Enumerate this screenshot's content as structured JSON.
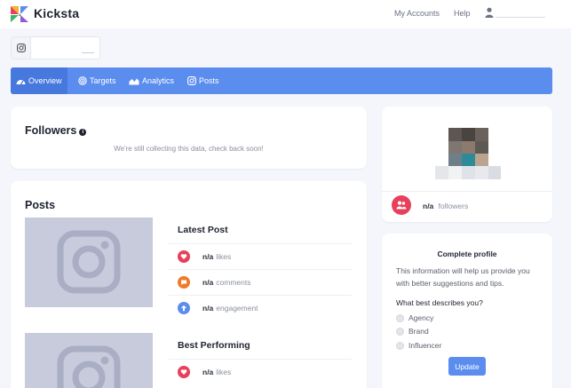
{
  "header": {
    "brand": "Kicksta",
    "links": {
      "my_accounts": "My Accounts",
      "help": "Help"
    },
    "icons": {
      "logo": "kicksta-logo",
      "user": "user-icon"
    }
  },
  "account": {
    "icon": "instagram-icon"
  },
  "nav": {
    "tabs": [
      {
        "label": "Overview",
        "icon": "dashboard-icon",
        "active": true
      },
      {
        "label": "Targets",
        "icon": "target-icon",
        "active": false
      },
      {
        "label": "Analytics",
        "icon": "chart-icon",
        "active": false
      },
      {
        "label": "Posts",
        "icon": "instagram-icon",
        "active": false
      }
    ]
  },
  "followers_card": {
    "title": "Followers",
    "message": "We're still collecting this data, check back soon!"
  },
  "posts_card": {
    "title": "Posts",
    "latest": {
      "title": "Latest Post",
      "stats": [
        {
          "value": "n/a",
          "label": "likes",
          "icon": "heart-icon",
          "color": "#e8405a"
        },
        {
          "value": "n/a",
          "label": "comments",
          "icon": "comment-icon",
          "color": "#f07a2a"
        },
        {
          "value": "n/a",
          "label": "engagement",
          "icon": "arrow-up-icon",
          "color": "#5b8dee"
        }
      ]
    },
    "best": {
      "title": "Best Performing",
      "stats": [
        {
          "value": "n/a",
          "label": "likes",
          "icon": "heart-icon",
          "color": "#e8405a"
        }
      ]
    }
  },
  "profile_card": {
    "followers_value": "n/a",
    "followers_label": "followers",
    "followers_icon": "people-icon"
  },
  "complete_profile": {
    "title": "Complete profile",
    "description_line1": "This information will help us provide you",
    "description_line2": "with better suggestions and tips.",
    "question": "What best describes you?",
    "options": [
      "Agency",
      "Brand",
      "Influencer"
    ],
    "button": "Update"
  },
  "colors": {
    "accent": "#5b8dee",
    "accent_active": "#4778de",
    "likes": "#e8405a",
    "comments": "#f07a2a",
    "engagement": "#5b8dee",
    "placeholder": "#c7cbdc"
  }
}
